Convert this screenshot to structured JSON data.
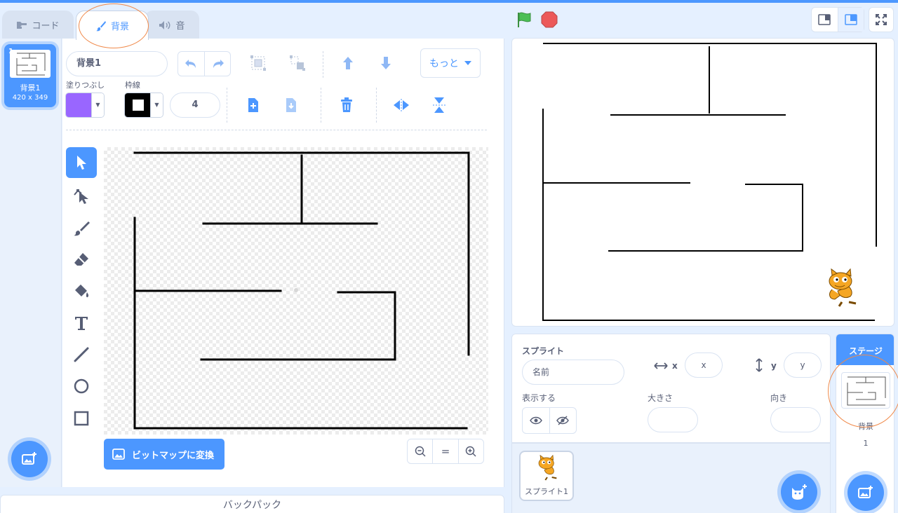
{
  "tabs": {
    "code": "コード",
    "backdrops": "背景",
    "sounds": "音"
  },
  "costume_list": {
    "items": [
      {
        "number": "1",
        "name": "背景1",
        "size": "420 x 349"
      }
    ]
  },
  "paint_editor": {
    "costume_name": "背景1",
    "fill_label": "塗りつぶし",
    "outline_label": "枠線",
    "fill_color": "#9966ff",
    "outline_color": "#000000",
    "stroke_width": "4",
    "more_label": "もっと",
    "convert_label": "ビットマップに変換",
    "zoom_reset_label": "="
  },
  "backpack": {
    "label": "バックパック"
  },
  "sprite_info": {
    "title": "スプライト",
    "name_placeholder": "名前",
    "x_label": "x",
    "x_placeholder": "x",
    "y_label": "y",
    "y_placeholder": "y",
    "show_label": "表示する",
    "size_label": "大きさ",
    "direction_label": "向き"
  },
  "sprites": [
    {
      "name": "スプライト1"
    }
  ],
  "stage_selector": {
    "header": "ステージ",
    "label": "背景",
    "backdrop_count": "1"
  },
  "colors": {
    "accent": "#4c97ff",
    "highlight_ring": "#f08a4b",
    "flag_green": "#4cbf56",
    "stop_red": "#ec5959"
  }
}
